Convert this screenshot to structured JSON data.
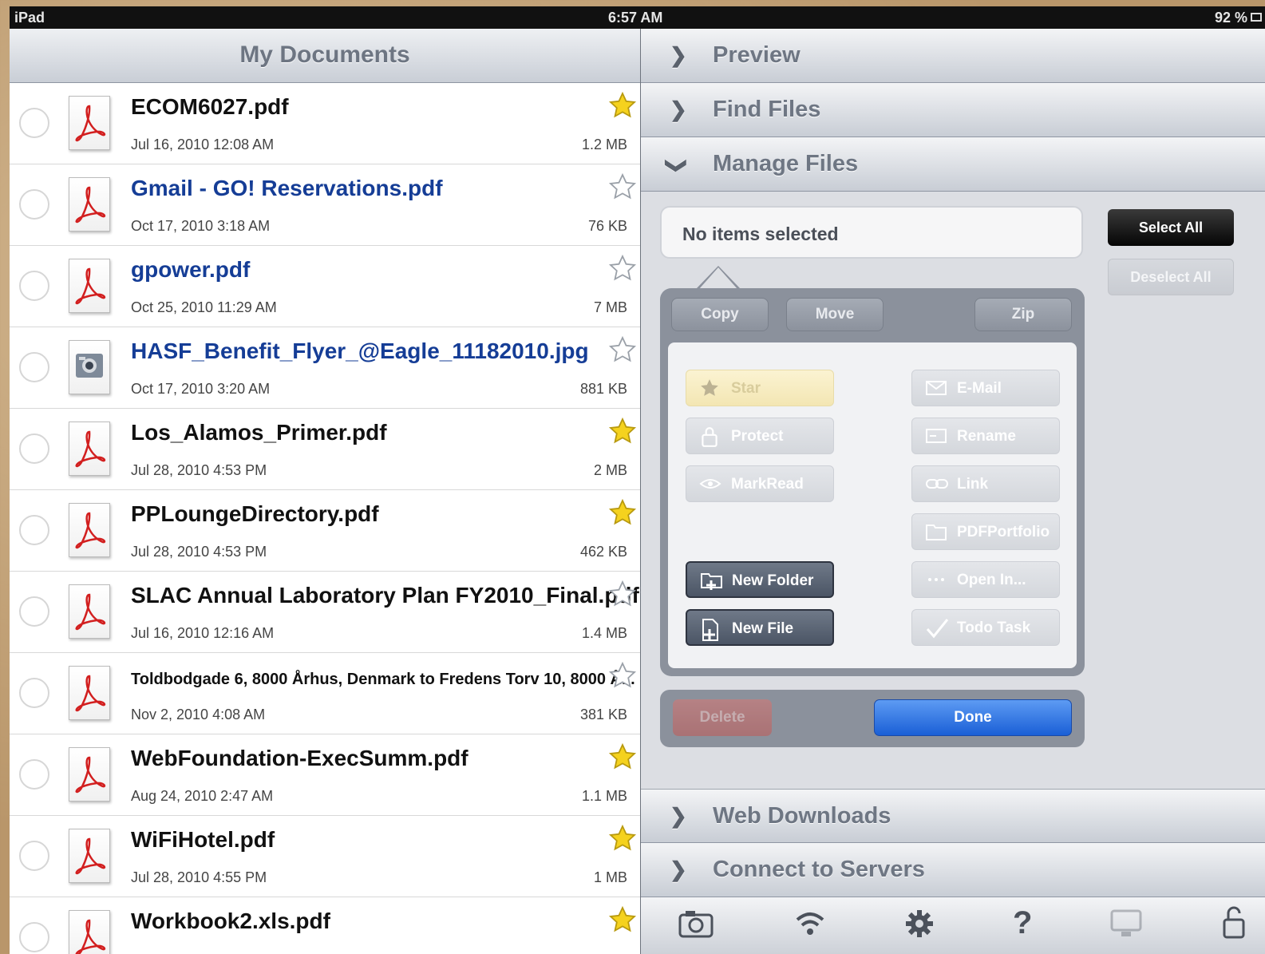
{
  "status": {
    "device": "iPad",
    "time": "6:57 AM",
    "battery": "92 %"
  },
  "left": {
    "title": "My Documents",
    "docs": [
      {
        "name": "ECOM6027.pdf",
        "date": "Jul 16, 2010 12:08 AM",
        "size": "1.2 MB",
        "starred": true,
        "unread": false,
        "type": "pdf"
      },
      {
        "name": "Gmail - GO! Reservations.pdf",
        "date": "Oct 17, 2010 3:18 AM",
        "size": "76 KB",
        "starred": false,
        "unread": true,
        "type": "pdf"
      },
      {
        "name": "gpower.pdf",
        "date": "Oct 25, 2010 11:29 AM",
        "size": "7 MB",
        "starred": false,
        "unread": true,
        "type": "pdf"
      },
      {
        "name": "HASF_Benefit_Flyer_@Eagle_11182010.jpg",
        "date": "Oct 17, 2010 3:20 AM",
        "size": "881 KB",
        "starred": false,
        "unread": true,
        "type": "jpg"
      },
      {
        "name": "Los_Alamos_Primer.pdf",
        "date": "Jul 28, 2010 4:53 PM",
        "size": "2 MB",
        "starred": true,
        "unread": false,
        "type": "pdf"
      },
      {
        "name": "PPLoungeDirectory.pdf",
        "date": "Jul 28, 2010 4:53 PM",
        "size": "462 KB",
        "starred": true,
        "unread": false,
        "type": "pdf"
      },
      {
        "name": "SLAC Annual Laboratory Plan FY2010_Final.pdf",
        "date": "Jul 16, 2010 12:16 AM",
        "size": "1.4 MB",
        "starred": false,
        "unread": false,
        "type": "pdf",
        "small": false
      },
      {
        "name": "Toldbodgade 6, 8000 Århus, Denmark to Fredens Torv 10, 8000 Å...",
        "date": "Nov 2, 2010 4:08 AM",
        "size": "381 KB",
        "starred": false,
        "unread": false,
        "type": "pdf",
        "small": true
      },
      {
        "name": "WebFoundation-ExecSumm.pdf",
        "date": "Aug 24, 2010 2:47 AM",
        "size": "1.1 MB",
        "starred": true,
        "unread": false,
        "type": "pdf"
      },
      {
        "name": "WiFiHotel.pdf",
        "date": "Jul 28, 2010 4:55 PM",
        "size": "1 MB",
        "starred": true,
        "unread": false,
        "type": "pdf"
      },
      {
        "name": "Workbook2.xls.pdf",
        "date": "",
        "size": "",
        "starred": true,
        "unread": false,
        "type": "pdf"
      }
    ]
  },
  "right": {
    "sections": {
      "preview": "Preview",
      "find_files": "Find Files",
      "manage_files": "Manage Files",
      "web_downloads": "Web Downloads",
      "connect_servers": "Connect to Servers"
    },
    "selection_text": "No items selected",
    "select_all": "Select All",
    "deselect_all": "Deselect All",
    "segments": {
      "copy": "Copy",
      "move": "Move",
      "zip": "Zip"
    },
    "actions": {
      "star": "Star",
      "protect": "Protect",
      "markread": "MarkRead",
      "email": "E-Mail",
      "rename": "Rename",
      "link": "Link",
      "pdfportfolio": "PDFPortfolio",
      "open_in": "Open In...",
      "todo_task": "Todo Task",
      "new_folder": "New Folder",
      "new_file": "New File"
    },
    "delete": "Delete",
    "done": "Done",
    "toolbar_icons": [
      "camera-icon",
      "wifi-icon",
      "gear-icon",
      "help-icon",
      "monitor-icon",
      "lock-icon"
    ]
  },
  "colors": {
    "unread_blue": "#153d96",
    "done_blue": "#1a5fd6",
    "star_gold": "#f5d21e"
  }
}
